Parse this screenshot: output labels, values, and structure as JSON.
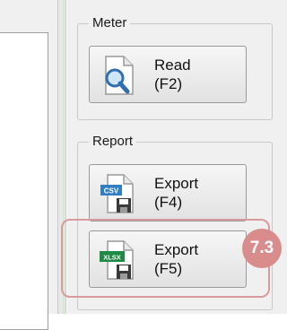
{
  "meter_group": {
    "title": "Meter",
    "read_button": {
      "line1": "Read",
      "line2": "(F2)",
      "icon": "document-magnifier-icon"
    }
  },
  "report_group": {
    "title": "Report",
    "export_csv_button": {
      "line1": "Export",
      "line2": "(F4)",
      "icon": "csv-save-icon",
      "icon_text": "CSV"
    },
    "export_xlsx_button": {
      "line1": "Export",
      "line2": "(F5)",
      "icon": "xlsx-save-icon",
      "icon_text": "XLSX"
    }
  },
  "annotation": {
    "badge_text": "7.3",
    "color": "#d98c8c"
  }
}
